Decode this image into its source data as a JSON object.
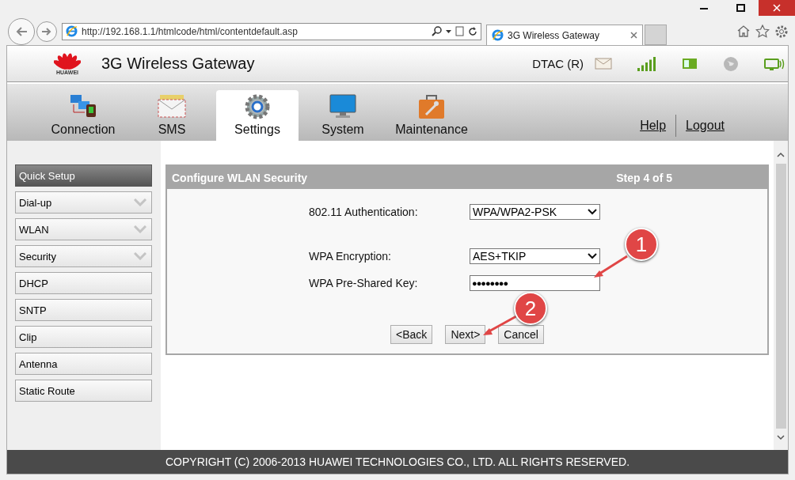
{
  "browser": {
    "url": "http://192.168.1.1/htmlcode/html/contentdefault.asp",
    "tab_title": "3G Wireless Gateway"
  },
  "header": {
    "brand": "HUAWEI",
    "title": "3G Wireless Gateway",
    "operator": "DTAC (R)"
  },
  "nav": {
    "tabs": [
      {
        "label": "Connection",
        "selected": false,
        "kind": "connection"
      },
      {
        "label": "SMS",
        "selected": false,
        "kind": "sms"
      },
      {
        "label": "Settings",
        "selected": true,
        "kind": "settings"
      },
      {
        "label": "System",
        "selected": false,
        "kind": "system"
      },
      {
        "label": "Maintenance",
        "selected": false,
        "kind": "maintenance"
      }
    ],
    "links": [
      "Help",
      "Logout"
    ]
  },
  "sidebar": {
    "items": [
      {
        "label": "Quick Setup",
        "selected": true,
        "expandable": false
      },
      {
        "label": "Dial-up",
        "selected": false,
        "expandable": true
      },
      {
        "label": "WLAN",
        "selected": false,
        "expandable": true
      },
      {
        "label": "Security",
        "selected": false,
        "expandable": true
      },
      {
        "label": "DHCP",
        "selected": false,
        "expandable": false
      },
      {
        "label": "SNTP",
        "selected": false,
        "expandable": false
      },
      {
        "label": "Clip",
        "selected": false,
        "expandable": false
      },
      {
        "label": "Antenna",
        "selected": false,
        "expandable": false
      },
      {
        "label": "Static Route",
        "selected": false,
        "expandable": false
      }
    ]
  },
  "form": {
    "title": "Configure WLAN Security",
    "step": "Step 4 of 5",
    "fields": [
      {
        "label": "802.11 Authentication:",
        "kind": "select",
        "value": "WPA/WPA2-PSK"
      },
      {
        "label": "WPA Encryption:",
        "kind": "select",
        "value": "AES+TKIP"
      },
      {
        "label": "WPA Pre-Shared Key:",
        "kind": "password",
        "value": "●●●●●●●●"
      }
    ],
    "buttons": [
      "<Back",
      "Next>",
      "Cancel"
    ]
  },
  "annotations": [
    {
      "label": "1"
    },
    {
      "label": "2"
    }
  ],
  "footer": "COPYRIGHT (C) 2006-2013 HUAWEI TECHNOLOGIES CO., LTD. ALL RIGHTS RESERVED."
}
